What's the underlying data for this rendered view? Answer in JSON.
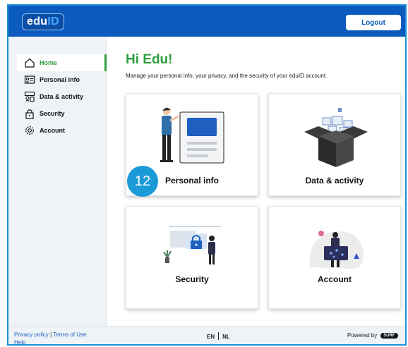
{
  "header": {
    "logo_main": "edu",
    "logo_accent": "ID",
    "logout_label": "Logout"
  },
  "sidebar": {
    "items": [
      {
        "label": "Home",
        "icon": "home-icon",
        "active": true
      },
      {
        "label": "Personal info",
        "icon": "id-card-icon"
      },
      {
        "label": "Data & activity",
        "icon": "data-activity-icon"
      },
      {
        "label": "Security",
        "icon": "lock-icon"
      },
      {
        "label": "Account",
        "icon": "gear-icon"
      }
    ]
  },
  "main": {
    "greeting": "Hi Edu!",
    "subtitle": "Manage your personal info, your privacy, and the security of your eduID account.",
    "badge": "12",
    "cards": [
      {
        "label": "Personal info",
        "icon": "personal-info-illustration"
      },
      {
        "label": "Data & activity",
        "icon": "data-activity-illustration"
      },
      {
        "label": "Security",
        "icon": "security-illustration"
      },
      {
        "label": "Account",
        "icon": "account-illustration"
      }
    ]
  },
  "footer": {
    "privacy_label": "Privacy policy",
    "link_separator": "|",
    "terms_label": "Terms of Use",
    "help_label": "Help",
    "lang_en": "EN",
    "lang_nl": "NL",
    "powered_by": "Powered by",
    "brand": "SURF"
  },
  "colors": {
    "header_blue": "#0b5bbf",
    "accent_green": "#2e9e3e",
    "badge_blue": "#1a9ad6",
    "sidebar_bg": "#eef3f8"
  }
}
